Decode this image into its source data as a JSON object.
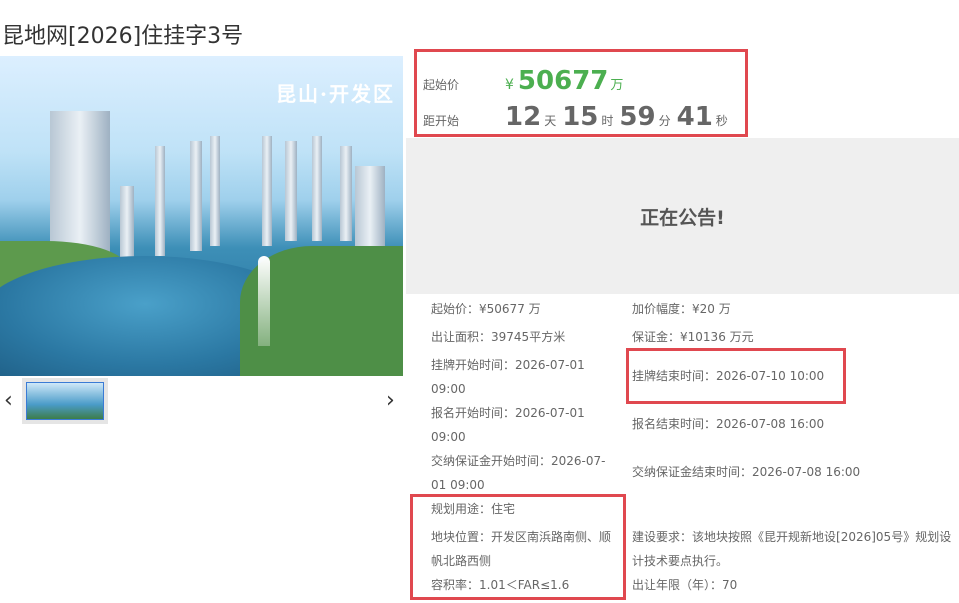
{
  "title": "昆地网[2026]住挂字3号",
  "photo": {
    "overlay_label": "昆山·开发区"
  },
  "gallery": {
    "prev_icon": "‹",
    "next_icon": "›"
  },
  "price_box": {
    "start_price_label": "起始价",
    "currency": "¥",
    "start_price": "50677",
    "unit": "万",
    "countdown_label": "距开始",
    "days": "12",
    "days_unit": "天",
    "hours": "15",
    "hours_unit": "时",
    "minutes": "59",
    "minutes_unit": "分",
    "seconds": "41",
    "seconds_unit": "秒"
  },
  "notice": "正在公告!",
  "info": {
    "start_price": {
      "label": "起始价：",
      "value": "¥50677 万"
    },
    "increment": {
      "label": "加价幅度：",
      "value": "¥20 万"
    },
    "area": {
      "label": "出让面积：",
      "value": "39745平方米"
    },
    "deposit": {
      "label": "保证金：",
      "value": "¥10136 万元"
    },
    "listing_start": {
      "label": "挂牌开始时间：",
      "value_line1": "2026-07-01",
      "value_line2": "09:00"
    },
    "listing_end": {
      "label": "挂牌结束时间：",
      "value": "2026-07-10 10:00"
    },
    "signup_start": {
      "label": "报名开始时间：",
      "value_line1": "2026-07-01",
      "value_line2": "09:00"
    },
    "signup_end": {
      "label": "报名结束时间：",
      "value": "2026-07-08 16:00"
    },
    "deposit_start": {
      "label": "交纳保证金开始时间：",
      "value_line1": "2026-07-",
      "value_line2": "01 09:00"
    },
    "deposit_end": {
      "label": "交纳保证金结束时间：",
      "value": "2026-07-08 16:00"
    },
    "planned_use": {
      "label": "规划用途：",
      "value": "住宅"
    },
    "location": {
      "label": "地块位置：",
      "value_line1": "开发区南浜路南侧、顺",
      "value_line2": "帆北路西侧"
    },
    "plot_ratio": {
      "label": "容积率：",
      "value": "1.01＜FAR≤1.6"
    },
    "build_req": {
      "label": "建设要求：",
      "value_line1": "该地块按照《昆开规新地设[2026]05号》规划设",
      "value_line2": "计技术要点执行。"
    },
    "lease_term": {
      "label": "出让年限（年）：",
      "value": "70"
    }
  },
  "colors": {
    "highlight": "#e0484f",
    "price_green": "#4caf50",
    "notice_bg": "#efefef"
  }
}
